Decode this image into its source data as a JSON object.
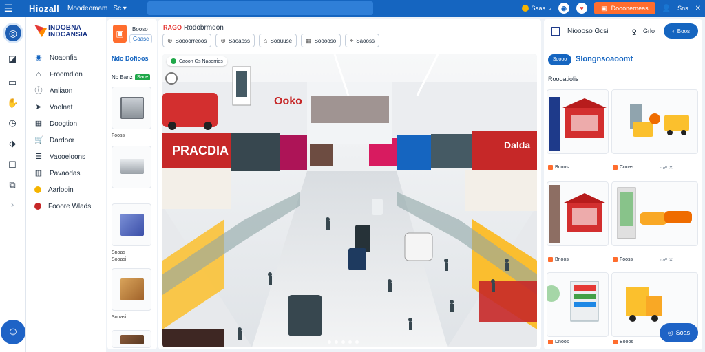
{
  "topbar": {
    "brand": "Hiozall",
    "crumb": "Moodeomam",
    "crumb2": "Sc",
    "search_placeholder": "",
    "coin_label": "Saas",
    "cta_label": "Dooonerneas"
  },
  "nav": {
    "title_line1": "INDOBNA",
    "title_line2": "INDCANSIA",
    "items": [
      {
        "label": "Noaonfia"
      },
      {
        "label": "Froomdion"
      },
      {
        "label": "Anliaon"
      },
      {
        "label": "Voolnat"
      },
      {
        "label": "Doogtion"
      },
      {
        "label": "Dardoor"
      },
      {
        "label": "Vaooeloons"
      },
      {
        "label": "Pavaodas"
      },
      {
        "label": "Aarlooin"
      },
      {
        "label": "Fooore Wlads"
      }
    ]
  },
  "product_col": {
    "brand_name": "Booso",
    "brand_sub": "Goasc",
    "section": "Ndo Dofioos",
    "sub": "No Banz",
    "tag": "Sane",
    "labels": [
      "Fooss",
      "Snoas",
      "Sooasi",
      "Sooasi"
    ]
  },
  "main": {
    "badge": "RAGO",
    "title": "Rodobrmdon",
    "filters": [
      {
        "label": "Soooorreoos"
      },
      {
        "label": "Saoaoss"
      },
      {
        "label": "Soouuse"
      },
      {
        "label": "Sooooso"
      },
      {
        "label": "Saooss"
      }
    ],
    "hero_badge": "Caoon Gs Naoorrios",
    "signs": [
      "PRACDIA",
      "Ooko",
      "Dalda"
    ]
  },
  "right": {
    "title": "Nioooso Gcsi",
    "more": "ꝿ",
    "info": "Grlo",
    "button": "Boos",
    "pill": "Soooo",
    "heading": "Slongnsoaoomt",
    "section": "Roooatiolis",
    "cards": [
      {
        "label": "Bnoos"
      },
      {
        "label": "Cooas"
      },
      {
        "label": "Bnoos"
      },
      {
        "label": "Fooss"
      },
      {
        "label": "Dnoos"
      },
      {
        "label": "Booos"
      }
    ],
    "chat": "Soas"
  }
}
